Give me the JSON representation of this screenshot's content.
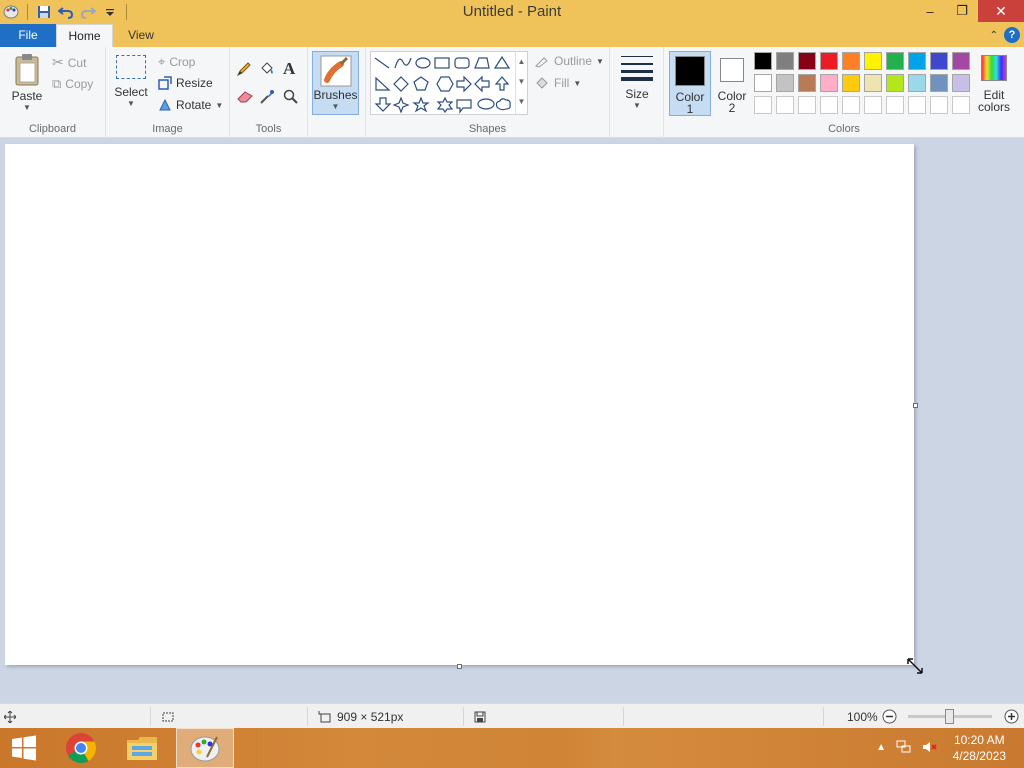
{
  "window": {
    "title": "Untitled - Paint"
  },
  "tabs": {
    "file": "File",
    "home": "Home",
    "view": "View"
  },
  "clipboard": {
    "label": "Clipboard",
    "paste": "Paste",
    "cut": "Cut",
    "copy": "Copy"
  },
  "image": {
    "label": "Image",
    "select": "Select",
    "crop": "Crop",
    "resize": "Resize",
    "rotate": "Rotate"
  },
  "tools": {
    "label": "Tools"
  },
  "brushes": {
    "label": "Brushes"
  },
  "shapes": {
    "label": "Shapes",
    "outline": "Outline",
    "fill": "Fill"
  },
  "size": {
    "label": "Size"
  },
  "color1": {
    "label": "Color",
    "num": "1",
    "value": "#000000"
  },
  "color2": {
    "label": "Color",
    "num": "2",
    "value": "#ffffff"
  },
  "colors": {
    "label": "Colors",
    "edit_line1": "Edit",
    "edit_line2": "colors",
    "row1": [
      "#000000",
      "#7f7f7f",
      "#880015",
      "#ed1c24",
      "#ff7f27",
      "#fff200",
      "#22b14c",
      "#00a2e8",
      "#3f48cc",
      "#a349a4"
    ],
    "row2": [
      "#ffffff",
      "#c3c3c3",
      "#b97a57",
      "#ffaec9",
      "#ffc90e",
      "#efe4b0",
      "#b5e61d",
      "#99d9ea",
      "#7092be",
      "#c8bfe7"
    ],
    "row3": [
      "#ffffff",
      "#ffffff",
      "#ffffff",
      "#ffffff",
      "#ffffff",
      "#ffffff",
      "#ffffff",
      "#ffffff",
      "#ffffff",
      "#ffffff"
    ]
  },
  "status": {
    "dimensions": "909 × 521px",
    "zoom": "100%",
    "zoom_level": 1.0
  },
  "taskbar": {
    "time": "10:20 AM",
    "date": "4/28/2023"
  }
}
